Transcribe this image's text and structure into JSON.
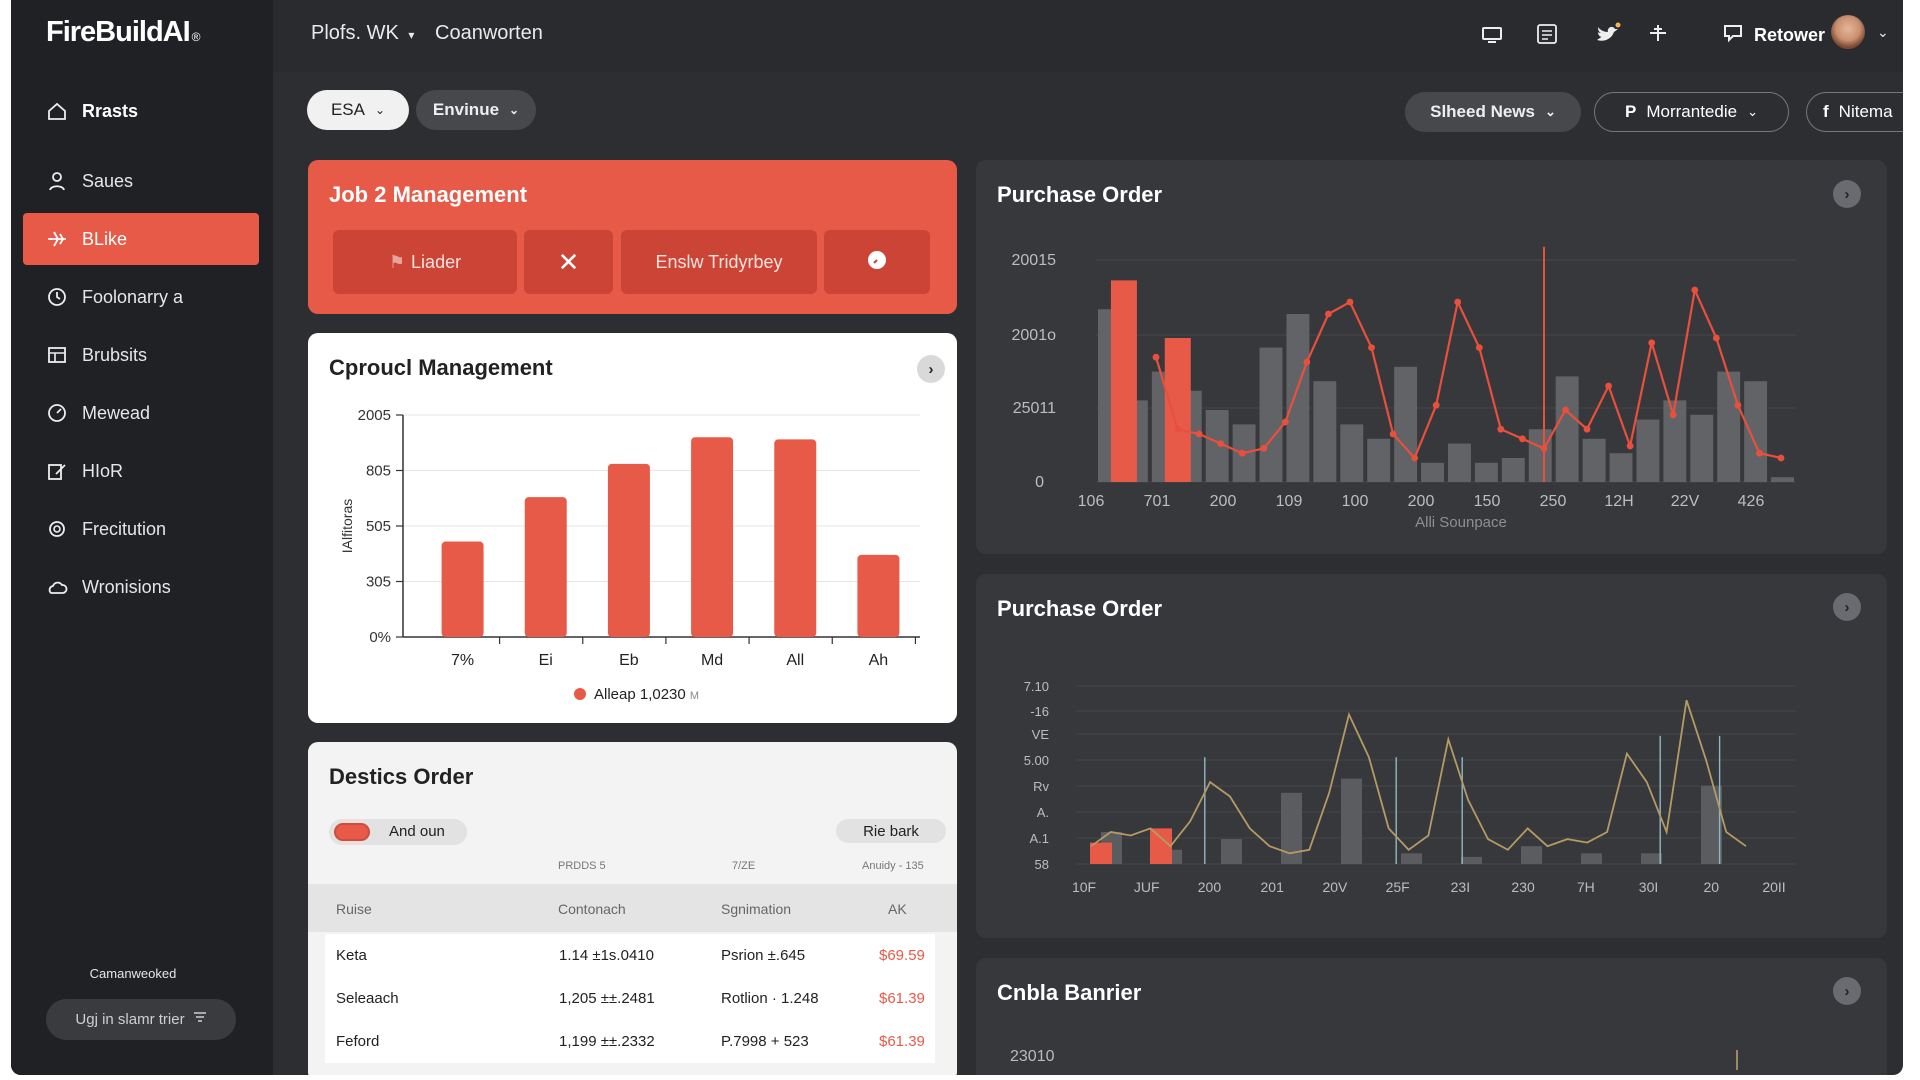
{
  "app": {
    "logo": "FireBuildAI",
    "logo_mark": "®"
  },
  "sidebar": {
    "items": [
      {
        "label": "Rrasts",
        "icon": "home-icon"
      },
      {
        "label": "Saues",
        "icon": "user-icon"
      },
      {
        "label": "BLike",
        "icon": "plane-icon"
      },
      {
        "label": "Foolonarry a",
        "icon": "clock-icon"
      },
      {
        "label": "Brubsits",
        "icon": "table-icon"
      },
      {
        "label": "Mewead",
        "icon": "gauge-icon"
      },
      {
        "label": "HIoR",
        "icon": "edit-icon"
      },
      {
        "label": "Frecitution",
        "icon": "settings-icon"
      },
      {
        "label": "Wronisions",
        "icon": "cloud-icon"
      }
    ],
    "active_index": 2,
    "footer_text": "Camanweoked",
    "footer_button": "Ugj in slamr trier"
  },
  "header": {
    "crumb1": "Plofs. WK",
    "crumb2": "Coanworten",
    "user_label": "Retower"
  },
  "filters": {
    "left1": "ESA",
    "left2": "Envinue",
    "right1": "Slheed News",
    "right2": "Morrantedie",
    "right3": "Nitema"
  },
  "job_card": {
    "title": "Job 2 Management",
    "btn1": "Liader",
    "btn3": "Enslw Tridyrbey"
  },
  "product_card": {
    "title": "Cproucl Management",
    "legend": "Alleap 1,0230",
    "legend_unit": "M"
  },
  "orders_card": {
    "title": "Destics Order",
    "toggle_label": "And oun",
    "action_label": "Rie bark",
    "sub_headers": [
      "PRDDS 5",
      "7/ZE",
      "Anuidy - 135"
    ],
    "headers": [
      "Ruise",
      "Contonach",
      "Sgnimation",
      "AK"
    ],
    "rows": [
      {
        "name": "Keta",
        "contract": "1.14 ±1s.0410",
        "designation": "Psrion ±.645",
        "amount": "$69.59"
      },
      {
        "name": "Seleaach",
        "contract": "1,205 ±±.2481",
        "designation": "Rotlion · 1.248",
        "amount": "$61.39"
      },
      {
        "name": "Feford",
        "contract": "1,199 ±±.2332",
        "designation": "P.7998 + 523",
        "amount": "$61.39"
      }
    ]
  },
  "po_card1": {
    "title": "Purchase Order",
    "xlabel": "Alli Sounpace"
  },
  "po_card2": {
    "title": "Purchase Order"
  },
  "banner_card": {
    "title": "Cnbla Banrier",
    "first_tick": "23010"
  },
  "chart_data": [
    {
      "type": "bar",
      "title": "Cproucl Management",
      "ylabel": "IAlfitoras",
      "categories": [
        "7%",
        "Ei",
        "Eb",
        "Md",
        "All",
        "Ah"
      ],
      "values": [
        430,
        630,
        780,
        900,
        890,
        370
      ],
      "y_ticks": [
        "0%",
        "305",
        "505",
        "805",
        "2005"
      ],
      "y_tick_values": [
        0,
        250,
        500,
        750,
        1000
      ],
      "ylim": [
        0,
        1000
      ],
      "color": "#e85a48",
      "legend": "Alleap 1,0230",
      "grid": true
    },
    {
      "type": "bar",
      "title": "Purchase Order",
      "xlabel": "Alli Sounpace",
      "x_ticks": [
        "106",
        "701",
        "200",
        "109",
        "100",
        "200",
        "150",
        "250",
        "12H",
        "22V",
        "426"
      ],
      "y_ticks": [
        "0",
        "25011",
        "2001o",
        "20015"
      ],
      "ylim": [
        0,
        100
      ],
      "red_bars": [
        {
          "x": 0.5,
          "value": 84
        },
        {
          "x": 1.5,
          "value": 60
        }
      ],
      "gray_bars": [
        72,
        34,
        46,
        38,
        30,
        24,
        56,
        70,
        42,
        24,
        18,
        48,
        8,
        16,
        8,
        10,
        22,
        44,
        18,
        12,
        26,
        34,
        28,
        46,
        42,
        2
      ],
      "line": [
        52,
        22,
        20,
        16,
        12,
        14,
        25,
        50,
        70,
        75,
        56,
        20,
        10,
        32,
        75,
        56,
        22,
        18,
        14,
        30,
        22,
        40,
        15,
        58,
        28,
        80,
        60,
        32,
        12,
        10
      ],
      "spike": {
        "x": 6.4,
        "value": 98
      },
      "grid": true
    },
    {
      "type": "line",
      "title": "Purchase Order",
      "x_ticks": [
        "10F",
        "JUF",
        "200",
        "201",
        "20V",
        "25F",
        "23I",
        "230",
        "7H",
        "30I",
        "20",
        "20II"
      ],
      "y_ticks": [
        "58",
        "A.1",
        "A.",
        "Rv",
        "5.00",
        "VE",
        "-16",
        "7.10"
      ],
      "ylim": [
        0,
        100
      ],
      "red_bars": [
        12,
        20
      ],
      "gray_bars": [
        18,
        8,
        14,
        40,
        48,
        6,
        4,
        10,
        6,
        6,
        44
      ],
      "line": [
        10,
        18,
        16,
        20,
        10,
        24,
        46,
        38,
        20,
        10,
        6,
        8,
        40,
        84,
        60,
        20,
        8,
        16,
        70,
        36,
        14,
        8,
        20,
        10,
        14,
        12,
        18,
        62,
        46,
        18,
        92,
        58,
        18,
        10
      ],
      "grid": true
    }
  ]
}
